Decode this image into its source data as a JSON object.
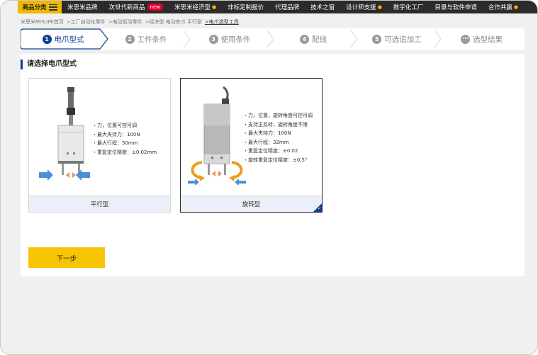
{
  "nav": {
    "category_label": "商品分类",
    "items": [
      {
        "label": "米思米品牌",
        "has_dropdown": false,
        "badge": ""
      },
      {
        "label": "次世代新商品",
        "has_dropdown": false,
        "badge": "new"
      },
      {
        "label": "米思米经济型",
        "has_dropdown": true,
        "badge": ""
      },
      {
        "label": "非标定制报价",
        "has_dropdown": false,
        "badge": ""
      },
      {
        "label": "代理品牌",
        "has_dropdown": false,
        "badge": ""
      },
      {
        "label": "技术之窗",
        "has_dropdown": false,
        "badge": ""
      },
      {
        "label": "设计师支援",
        "has_dropdown": true,
        "badge": ""
      },
      {
        "label": "数字化工厂",
        "has_dropdown": false,
        "badge": ""
      },
      {
        "label": "目录与软件申请",
        "has_dropdown": false,
        "badge": ""
      },
      {
        "label": "合作共赢",
        "has_dropdown": true,
        "badge": ""
      }
    ],
    "accent_color": "#f2b800",
    "bg_color": "#2b2b2b"
  },
  "breadcrumb": [
    "米思米MISUMI首页",
    ">工厂自动化零件",
    ">电动驱动零件",
    ">经济型 电动夹爪 平行型",
    ">电爪选型工具"
  ],
  "steps": [
    {
      "num": "1",
      "label": "电爪型式",
      "active": true
    },
    {
      "num": "2",
      "label": "工件条件",
      "active": false
    },
    {
      "num": "3",
      "label": "使用条件",
      "active": false
    },
    {
      "num": "4",
      "label": "配线",
      "active": false
    },
    {
      "num": "5",
      "label": "可选追加工",
      "active": false
    },
    {
      "num": "•••",
      "label": "选型结果",
      "active": false
    }
  ],
  "section_title": "请选择电爪型式",
  "options": [
    {
      "name": "平行型",
      "selected": false,
      "specs": [
        "・力，位置可控可调",
        "・最大夹持力：100N",
        "・最大行程：50mm",
        "・重复定位精度：±0.02mm"
      ]
    },
    {
      "name": "旋转型",
      "selected": true,
      "specs": [
        "・力，位置，旋转角度可控可调",
        "・支持正反转，旋转角度不限",
        "・最大夹持力：100N",
        "・最大行程：32mm",
        "・重复定位精度：±0.02",
        "・旋转重复定位精度：±0.5°"
      ]
    }
  ],
  "next_button": "下一步",
  "colors": {
    "brand_blue": "#0d3f8f",
    "button_yellow": "#f6c400",
    "arrow_blue": "#4a90d9",
    "arrow_orange": "#e8905a"
  }
}
